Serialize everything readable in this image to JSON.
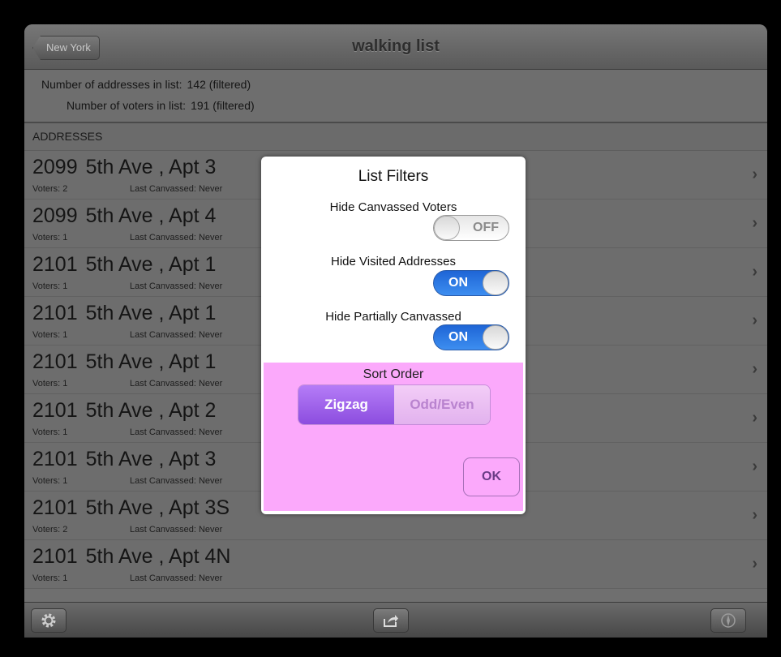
{
  "nav": {
    "back_label": "New York",
    "title": "walking list"
  },
  "summary": {
    "addresses_label": "Number of addresses in list:",
    "addresses_value": "142 (filtered)",
    "voters_label": "Number of voters in list:",
    "voters_value": "191 (filtered)"
  },
  "section_header": "ADDRESSES",
  "addresses": [
    {
      "number": "2099",
      "street": "5th Ave , Apt 3",
      "voters": "Voters: 2",
      "last_canvassed": "Last Canvassed: Never"
    },
    {
      "number": "2099",
      "street": "5th Ave , Apt 4",
      "voters": "Voters: 1",
      "last_canvassed": "Last Canvassed: Never"
    },
    {
      "number": "2101",
      "street": "5th Ave , Apt 1",
      "voters": "Voters: 1",
      "last_canvassed": "Last Canvassed: Never"
    },
    {
      "number": "2101",
      "street": "5th Ave , Apt 1",
      "voters": "Voters: 1",
      "last_canvassed": "Last Canvassed: Never"
    },
    {
      "number": "2101",
      "street": "5th Ave , Apt 1",
      "voters": "Voters: 1",
      "last_canvassed": "Last Canvassed: Never"
    },
    {
      "number": "2101",
      "street": "5th Ave , Apt 2",
      "voters": "Voters: 1",
      "last_canvassed": "Last Canvassed: Never"
    },
    {
      "number": "2101",
      "street": "5th Ave , Apt 3",
      "voters": "Voters: 1",
      "last_canvassed": "Last Canvassed: Never"
    },
    {
      "number": "2101",
      "street": "5th Ave , Apt 3S",
      "voters": "Voters: 2",
      "last_canvassed": "Last Canvassed: Never"
    },
    {
      "number": "2101",
      "street": "5th Ave , Apt 4N",
      "voters": "Voters: 1",
      "last_canvassed": "Last Canvassed: Never"
    }
  ],
  "chevron": "›",
  "dialog": {
    "title": "List Filters",
    "options": [
      {
        "label": "Hide Canvassed Voters",
        "state": "OFF"
      },
      {
        "label": "Hide Visited Addresses",
        "state": "ON"
      },
      {
        "label": "Hide Partially Canvassed",
        "state": "ON"
      }
    ],
    "sort_order_label": "Sort Order",
    "sort_options": [
      "Zigzag",
      "Odd/Even"
    ],
    "sort_selected": "Zigzag",
    "ok_label": "OK",
    "colors": {
      "sort_area": "#fba9fb",
      "switch_on": "#2a74e4",
      "segment_selected": "#9d5fe8"
    }
  },
  "toolbar": {
    "icons": [
      "gear-icon",
      "share-icon",
      "compass-icon"
    ]
  }
}
